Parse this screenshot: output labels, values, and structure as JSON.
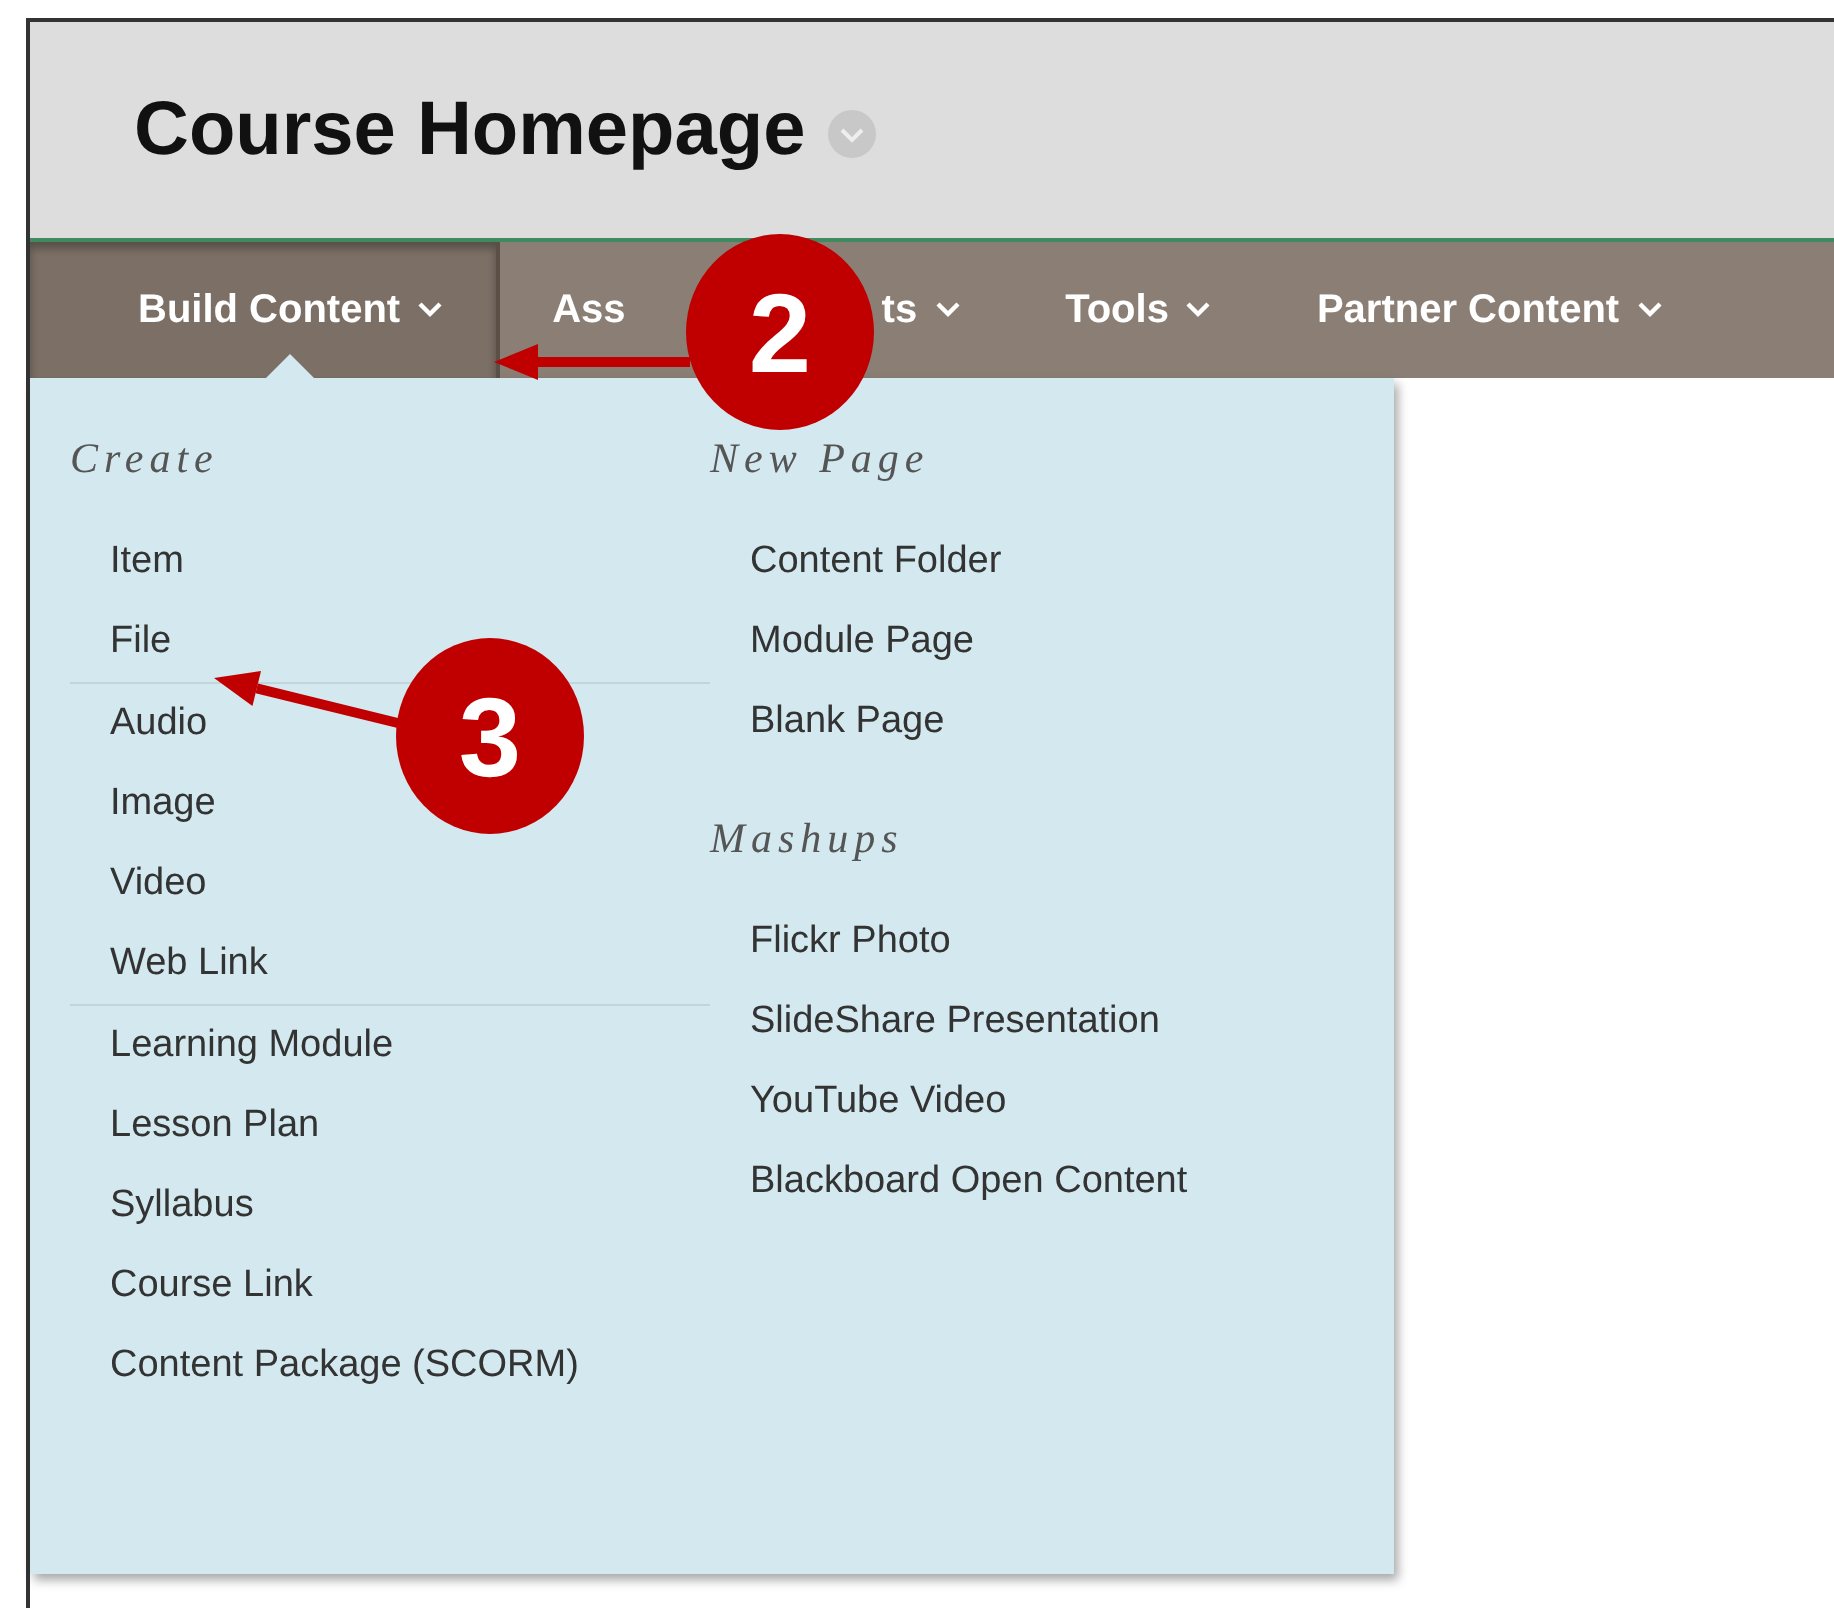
{
  "page": {
    "title": "Course Homepage"
  },
  "tabs": [
    {
      "label_parts": [
        "Build Content"
      ],
      "selected": true
    },
    {
      "label_parts": [
        "Ass",
        "ts"
      ],
      "selected": false
    },
    {
      "label_parts": [
        "Tools"
      ],
      "selected": false
    },
    {
      "label_parts": [
        "Partner Content"
      ],
      "selected": false
    }
  ],
  "menu": {
    "columns": [
      {
        "sections": [
          {
            "heading": "Create",
            "groups": [
              [
                "Item",
                "File"
              ],
              [
                "Audio",
                "Image",
                "Video",
                "Web Link"
              ],
              [
                "Learning Module",
                "Lesson Plan",
                "Syllabus",
                "Course Link",
                "Content Package (SCORM)"
              ]
            ]
          }
        ]
      },
      {
        "sections": [
          {
            "heading": "New Page",
            "groups": [
              [
                "Content Folder",
                "Module Page",
                "Blank Page"
              ]
            ]
          },
          {
            "heading": "Mashups",
            "groups": [
              [
                "Flickr Photo",
                "SlideShare Presentation",
                "YouTube Video",
                "Blackboard Open Content"
              ]
            ]
          }
        ]
      }
    ]
  },
  "callouts": [
    {
      "number": "2"
    },
    {
      "number": "3"
    }
  ]
}
